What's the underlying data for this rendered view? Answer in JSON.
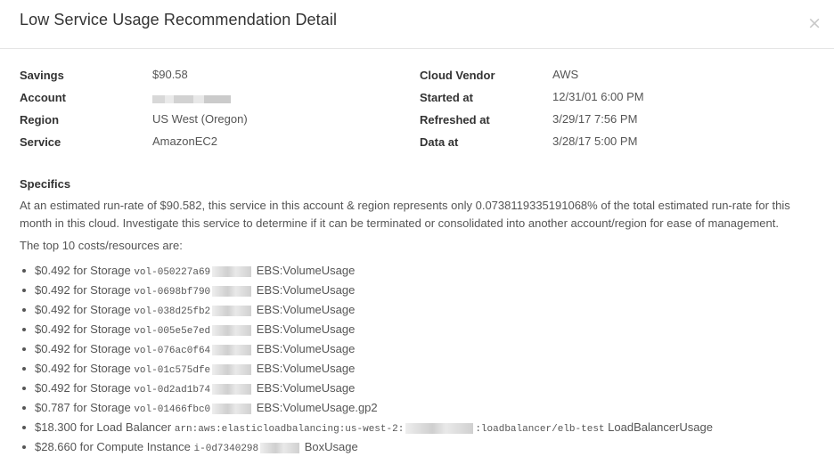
{
  "modal": {
    "title": "Low Service Usage Recommendation Detail",
    "close_label": "×"
  },
  "details": {
    "left": [
      {
        "label": "Savings",
        "value": "$90.58"
      },
      {
        "label": "Account",
        "value": ""
      },
      {
        "label": "Region",
        "value": "US West (Oregon)"
      },
      {
        "label": "Service",
        "value": "AmazonEC2"
      }
    ],
    "right": [
      {
        "label": "Cloud Vendor",
        "value": "AWS"
      },
      {
        "label": "Started at",
        "value": "12/31/01 6:00 PM"
      },
      {
        "label": "Refreshed at",
        "value": "3/29/17 7:56 PM"
      },
      {
        "label": "Data at",
        "value": "3/28/17 5:00 PM"
      }
    ]
  },
  "specifics": {
    "title": "Specifics",
    "text": "At an estimated run-rate of $90.582, this service in this account & region represents only 0.0738119335191068% of the total estimated run-rate for this month in this cloud. Investigate this service to determine if it can be terminated or consolidated into another account/region for ease of management.",
    "top_intro": "The top 10 costs/resources are:"
  },
  "costs": [
    {
      "prefix": "$0.492 for Storage",
      "resource": "vol-050227a69",
      "suffix": "EBS:VolumeUsage"
    },
    {
      "prefix": "$0.492 for Storage",
      "resource": "vol-0698bf790",
      "suffix": "EBS:VolumeUsage"
    },
    {
      "prefix": "$0.492 for Storage",
      "resource": "vol-038d25fb2",
      "suffix": "EBS:VolumeUsage"
    },
    {
      "prefix": "$0.492 for Storage",
      "resource": "vol-005e5e7ed",
      "suffix": "EBS:VolumeUsage"
    },
    {
      "prefix": "$0.492 for Storage",
      "resource": "vol-076ac0f64",
      "suffix": "EBS:VolumeUsage"
    },
    {
      "prefix": "$0.492 for Storage",
      "resource": "vol-01c575dfe",
      "suffix": "EBS:VolumeUsage"
    },
    {
      "prefix": "$0.492 for Storage",
      "resource": "vol-0d2ad1b74",
      "suffix": "EBS:VolumeUsage"
    },
    {
      "prefix": "$0.787 for Storage",
      "resource": "vol-01466fbc0",
      "suffix": "EBS:VolumeUsage.gp2"
    },
    {
      "prefix": "$18.300 for Load Balancer",
      "resource": "arn:aws:elasticloadbalancing:us-west-2:",
      "resource_tail": ":loadbalancer/elb-test",
      "suffix": "LoadBalancerUsage"
    },
    {
      "prefix": "$28.660 for Compute Instance",
      "resource": "i-0d7340298",
      "suffix": "BoxUsage"
    }
  ]
}
